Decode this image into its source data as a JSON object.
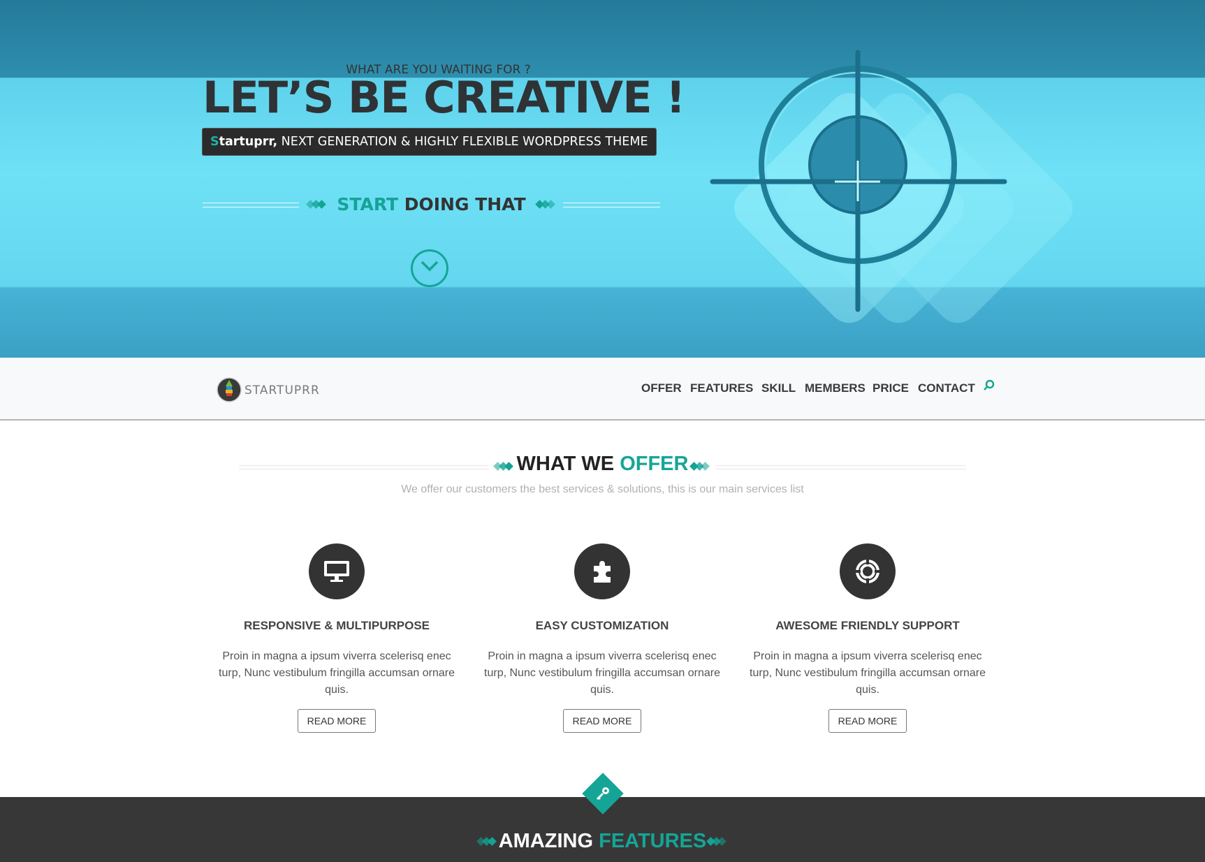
{
  "hero": {
    "kicker": "WHAT ARE YOU WAITING FOR ?",
    "headline": "LET’S BE CREATIVE !",
    "tagline_s": "S",
    "tagline_brand": "tartuprr,",
    "tagline_rest": " NEXT GENERATION & HIGHLY FLEXIBLE WORDPRESS THEME",
    "cta_highlight": "START",
    "cta_rest": " DOING THAT"
  },
  "navbar": {
    "logo_text": "STARTUPRR",
    "items": [
      "OFFER",
      "FEATURES",
      "SKILL",
      "MEMBERS",
      "PRICE",
      "CONTACT"
    ]
  },
  "offer": {
    "title_a": "WHAT WE ",
    "title_b": "OFFER",
    "subtitle": "We offer our customers the best services & solutions, this is our main services list",
    "services": [
      {
        "icon": "monitor-icon",
        "title": "RESPONSIVE & MULTIPURPOSE",
        "text": "Proin in magna a ipsum viverra scelerisq enec turp, Nunc vestibulum fringilla accumsan ornare quis.",
        "button": "READ MORE"
      },
      {
        "icon": "puzzle-icon",
        "title": "EASY CUSTOMIZATION",
        "text": "Proin in magna a ipsum viverra scelerisq enec turp, Nunc vestibulum fringilla accumsan ornare quis.",
        "button": "READ MORE"
      },
      {
        "icon": "lifebuoy-icon",
        "title": "AWESOME FRIENDLY SUPPORT",
        "text": "Proin in magna a ipsum viverra scelerisq enec turp, Nunc vestibulum fringilla accumsan ornare quis.",
        "button": "READ MORE"
      }
    ]
  },
  "features": {
    "title_a": "AMAZING ",
    "title_b": "FEATURES",
    "icon": "key-icon"
  },
  "colors": {
    "accent": "#15a596",
    "dark": "#373737",
    "hero": "#6fe1f6"
  }
}
